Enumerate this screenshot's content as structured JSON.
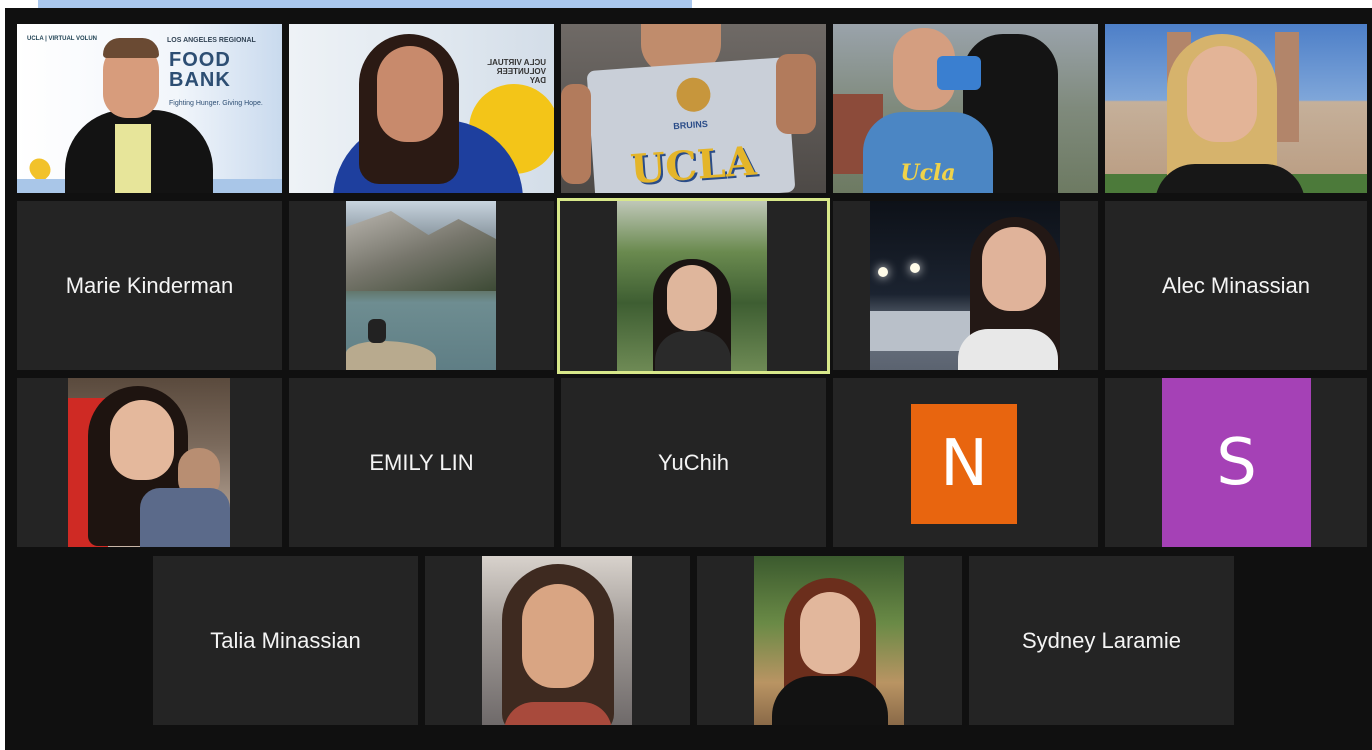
{
  "window": {
    "title": ""
  },
  "participants": [
    {
      "id": "p1",
      "label": "",
      "banner_top": "LOS ANGELES REGIONAL",
      "banner_brand": "FOOD BANK",
      "banner_tag": "Fighting Hunger. Giving Hope.",
      "banner_corner": "UCLA | VIRTUAL VOLUN"
    },
    {
      "id": "p2",
      "label": "",
      "mirror_text": "UCLA VIRTUAL VOLUNTEER DAY"
    },
    {
      "id": "p3",
      "label": "",
      "shirt_text": "UCLA",
      "shirt_sub": "BRUINS"
    },
    {
      "id": "p4",
      "label": "",
      "shirt_text": "Ucla"
    },
    {
      "id": "p5",
      "label": ""
    },
    {
      "id": "p6",
      "label": "Marie Kinderman"
    },
    {
      "id": "p7",
      "label": ""
    },
    {
      "id": "p8",
      "label": "",
      "active_speaker": true
    },
    {
      "id": "p9",
      "label": ""
    },
    {
      "id": "p10",
      "label": "Alec Minassian"
    },
    {
      "id": "p11",
      "label": ""
    },
    {
      "id": "p12",
      "label": "EMILY LIN"
    },
    {
      "id": "p13",
      "label": "YuChih"
    },
    {
      "id": "p14",
      "label": "",
      "avatar_letter": "N",
      "avatar_color": "#e8650f"
    },
    {
      "id": "p15",
      "label": "",
      "avatar_letter": "S",
      "avatar_color": "#a541b6"
    },
    {
      "id": "p16",
      "label": "Talia Minassian"
    },
    {
      "id": "p17",
      "label": ""
    },
    {
      "id": "p18",
      "label": ""
    },
    {
      "id": "p19",
      "label": "Sydney Laramie"
    }
  ],
  "colors": {
    "active_border": "#d8e88a",
    "tile_bg": "#242424",
    "frame_bg": "#101010"
  }
}
